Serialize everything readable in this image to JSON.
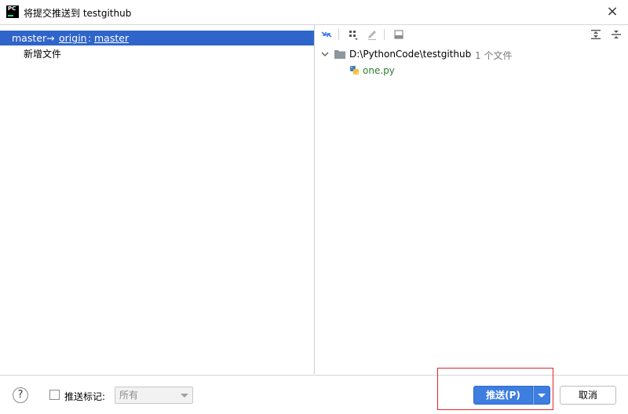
{
  "window": {
    "title": "将提交推送到 testgithub",
    "logo_text": "PC",
    "close_glyph": "×"
  },
  "commits": {
    "local_branch": "master",
    "arrow": "→",
    "remote": "origin",
    "separator": ":",
    "remote_branch": "master",
    "message": "新增文件"
  },
  "changes_tree": {
    "root_path": "D:\\PythonCode\\testgithub",
    "root_count": "1 个文件",
    "files": [
      "one.py"
    ]
  },
  "toolbar": {
    "icons": [
      "compare-icon",
      "group-by-icon",
      "edit-icon",
      "commit-details-icon",
      "expand-all-icon",
      "collapse-all-icon"
    ]
  },
  "footer": {
    "help_glyph": "?",
    "push_tags_label": "推送标记:",
    "push_tags_checked": false,
    "tags_option": "所有",
    "push_label": "推送(P)",
    "cancel_label": "取消"
  },
  "colors": {
    "selection": "#2f65ca",
    "primary_button": "#3d7ee0",
    "file_added": "#2e7d32",
    "highlight": "#e0262b"
  }
}
